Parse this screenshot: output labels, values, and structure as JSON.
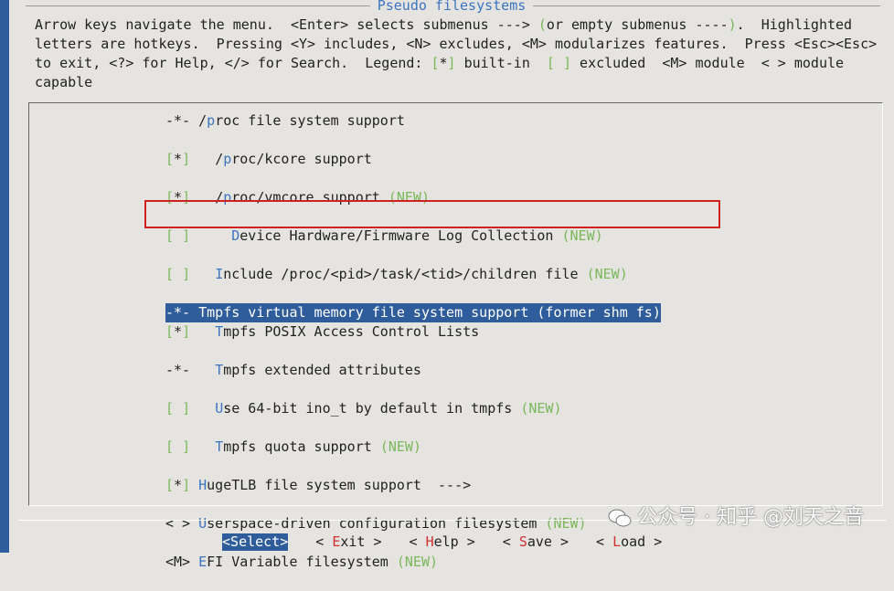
{
  "title": "Pseudo filesystems",
  "help_lines": [
    [
      "Arrow keys navigate the menu.  <Enter> selects submenus ---> ",
      "(",
      "or empty submenus ----",
      ")",
      ".  Highlighted"
    ],
    [
      "letters are hotkeys.  Pressing <Y> includes, <N> excludes, <M> modularizes features.  Press <Esc><Esc>"
    ],
    [
      "to exit, <?> for Help, </> for Search.  Legend: ",
      "[",
      "*",
      "]",
      " built-in  ",
      "[ ]",
      " excluded  <M> module  < > module"
    ],
    [
      "capable"
    ]
  ],
  "menu_items": [
    {
      "prefix": "-*- ",
      "indent": "",
      "hotkey": "",
      "text": "/proc file system support",
      "pre": "/",
      "hk": "p",
      "rest": "roc file system support",
      "tag": ""
    },
    {
      "prefix": "[*] ",
      "indent": "  ",
      "pre": "/",
      "hk": "p",
      "rest": "roc/kcore support",
      "tag": ""
    },
    {
      "prefix": "[*] ",
      "indent": "  ",
      "pre": "/",
      "hk": "p",
      "rest": "roc/vmcore support ",
      "tag": "(NEW)"
    },
    {
      "prefix": "[ ] ",
      "indent": "    ",
      "pre": "",
      "hk": "D",
      "rest": "evice Hardware/Firmware Log Collection ",
      "tag": "(NEW)"
    },
    {
      "prefix": "[ ] ",
      "indent": "  ",
      "pre": "",
      "hk": "I",
      "rest": "nclude /proc/<pid>/task/<tid>/children file ",
      "tag": "(NEW)"
    },
    {
      "prefix": "-*- ",
      "indent": "",
      "pre": "",
      "hk": "T",
      "rest": "mpfs virtual memory file system support (former shm fs)",
      "tag": "",
      "selected": true
    },
    {
      "prefix": "[*] ",
      "indent": "  ",
      "pre": "",
      "hk": "T",
      "rest": "mpfs POSIX Access Control Lists",
      "tag": ""
    },
    {
      "prefix": "-*- ",
      "indent": "  ",
      "pre": "",
      "hk": "T",
      "rest": "mpfs extended attributes",
      "tag": ""
    },
    {
      "prefix": "[ ] ",
      "indent": "  ",
      "pre": "",
      "hk": "U",
      "rest": "se 64-bit ino_t by default in tmpfs ",
      "tag": "(NEW)"
    },
    {
      "prefix": "[ ] ",
      "indent": "  ",
      "pre": "",
      "hk": "T",
      "rest": "mpfs quota support ",
      "tag": "(NEW)"
    },
    {
      "prefix": "[*] ",
      "indent": "",
      "pre": "",
      "hk": "H",
      "rest": "ugeTLB file system support  --->",
      "tag": ""
    },
    {
      "prefix": "< > ",
      "indent": "",
      "pre": "",
      "hk": "U",
      "rest": "serspace-driven configuration filesystem ",
      "tag": "(NEW)"
    },
    {
      "prefix": "<M> ",
      "indent": "",
      "pre": "",
      "hk": "E",
      "rest": "FI Variable filesystem ",
      "tag": "(NEW)"
    }
  ],
  "buttons": [
    {
      "left": "<",
      "hk": "S",
      "rest": "elect",
      "right": ">",
      "active": true
    },
    {
      "left": "< ",
      "hk": "E",
      "rest": "xit",
      "right": " >"
    },
    {
      "left": "< ",
      "hk": "H",
      "rest": "elp",
      "right": " >"
    },
    {
      "left": "< ",
      "hk": "S",
      "rest": "ave",
      "right": " >"
    },
    {
      "left": "< ",
      "hk": "L",
      "rest": "oad",
      "right": " >"
    }
  ],
  "watermark": "公众号 · 知乎 @刘天之音",
  "colors": {
    "accent": "#2f5d9c",
    "hotkey": "#3c75c0",
    "legend_green": "#7ab85a",
    "highlight_outline": "#d02020"
  }
}
